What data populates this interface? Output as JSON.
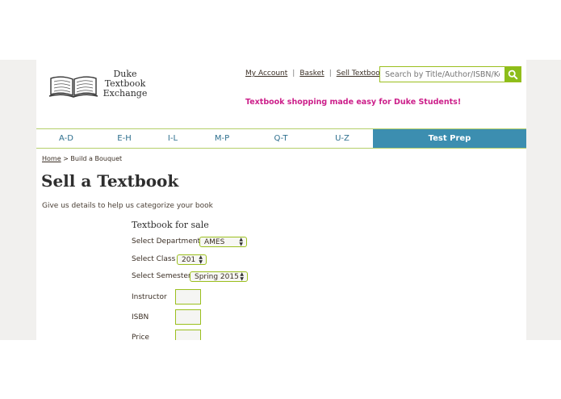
{
  "header": {
    "logo": [
      "Duke",
      "Textbook",
      "Exchange"
    ],
    "links": [
      "My Account",
      "Basket",
      "Sell Textbooks"
    ],
    "link_separator": "|",
    "search_placeholder": "Search by Title/Author/ISBN/Key",
    "tagline": "Textbook shopping made easy for Duke Students!"
  },
  "nav": {
    "items": [
      "A-D",
      "E-H",
      "I-L",
      "M-P",
      "Q-T",
      "U-Z"
    ],
    "test_prep": "Test Prep"
  },
  "breadcrumb": {
    "home": "Home",
    "separator": ">",
    "current": "Build a Bouquet"
  },
  "main": {
    "title": "Sell a Textbook",
    "subtitle": "Give us details to help us categorize your book",
    "form": {
      "heading": "Textbook for sale",
      "department_label": "Select Department",
      "department_value": "AMES",
      "class_label": "Select Class",
      "class_value": "201",
      "semester_label": "Select Semester",
      "semester_value": "Spring 2015",
      "instructor_label": "Instructor",
      "isbn_label": "ISBN",
      "price_label": "Price"
    }
  },
  "colors": {
    "accent_green": "#8cbd1a",
    "nav_blue": "#3c8eb0",
    "tagline_pink": "#cc1f8a"
  }
}
